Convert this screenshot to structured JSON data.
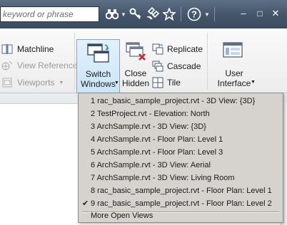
{
  "search": {
    "placeholder": "keyword or phrase"
  },
  "toolbar": {
    "help_glyph": "?"
  },
  "window": {
    "minimize_glyph": "–",
    "maximize_glyph": "□",
    "close_glyph": "✕"
  },
  "ribbon": {
    "matchline": "Matchline",
    "view_reference": "View Reference",
    "viewports": "Viewports",
    "switch_windows_line1": "Switch",
    "switch_windows_line2": "Windows",
    "close_hidden_line1": "Close",
    "close_hidden_line2": "Hidden",
    "replicate": "Replicate",
    "cascade": "Cascade",
    "tile": "Tile",
    "user_interface_line1": "User",
    "user_interface_line2": "Interface"
  },
  "menu": {
    "items": [
      {
        "label": "1 rac_basic_sample_project.rvt - 3D View: {3D}",
        "checked": false
      },
      {
        "label": "2 TestProject.rvt - Elevation: North",
        "checked": false
      },
      {
        "label": "3 ArchSample.rvt - 3D View: {3D}",
        "checked": false
      },
      {
        "label": "4 ArchSample.rvt - Floor Plan: Level 1",
        "checked": false
      },
      {
        "label": "5 ArchSample.rvt - Floor Plan: Level 3",
        "checked": false
      },
      {
        "label": "6 ArchSample.rvt - 3D View: Aerial",
        "checked": false
      },
      {
        "label": "7 ArchSample.rvt - 3D View: Living Room",
        "checked": false
      },
      {
        "label": "8 rac_basic_sample_project.rvt - Floor Plan: Level 1",
        "checked": false
      },
      {
        "label": "9 rac_basic_sample_project.rvt - Floor Plan: Level 2",
        "checked": true
      }
    ],
    "more": "More Open Views",
    "check_glyph": "✔"
  }
}
